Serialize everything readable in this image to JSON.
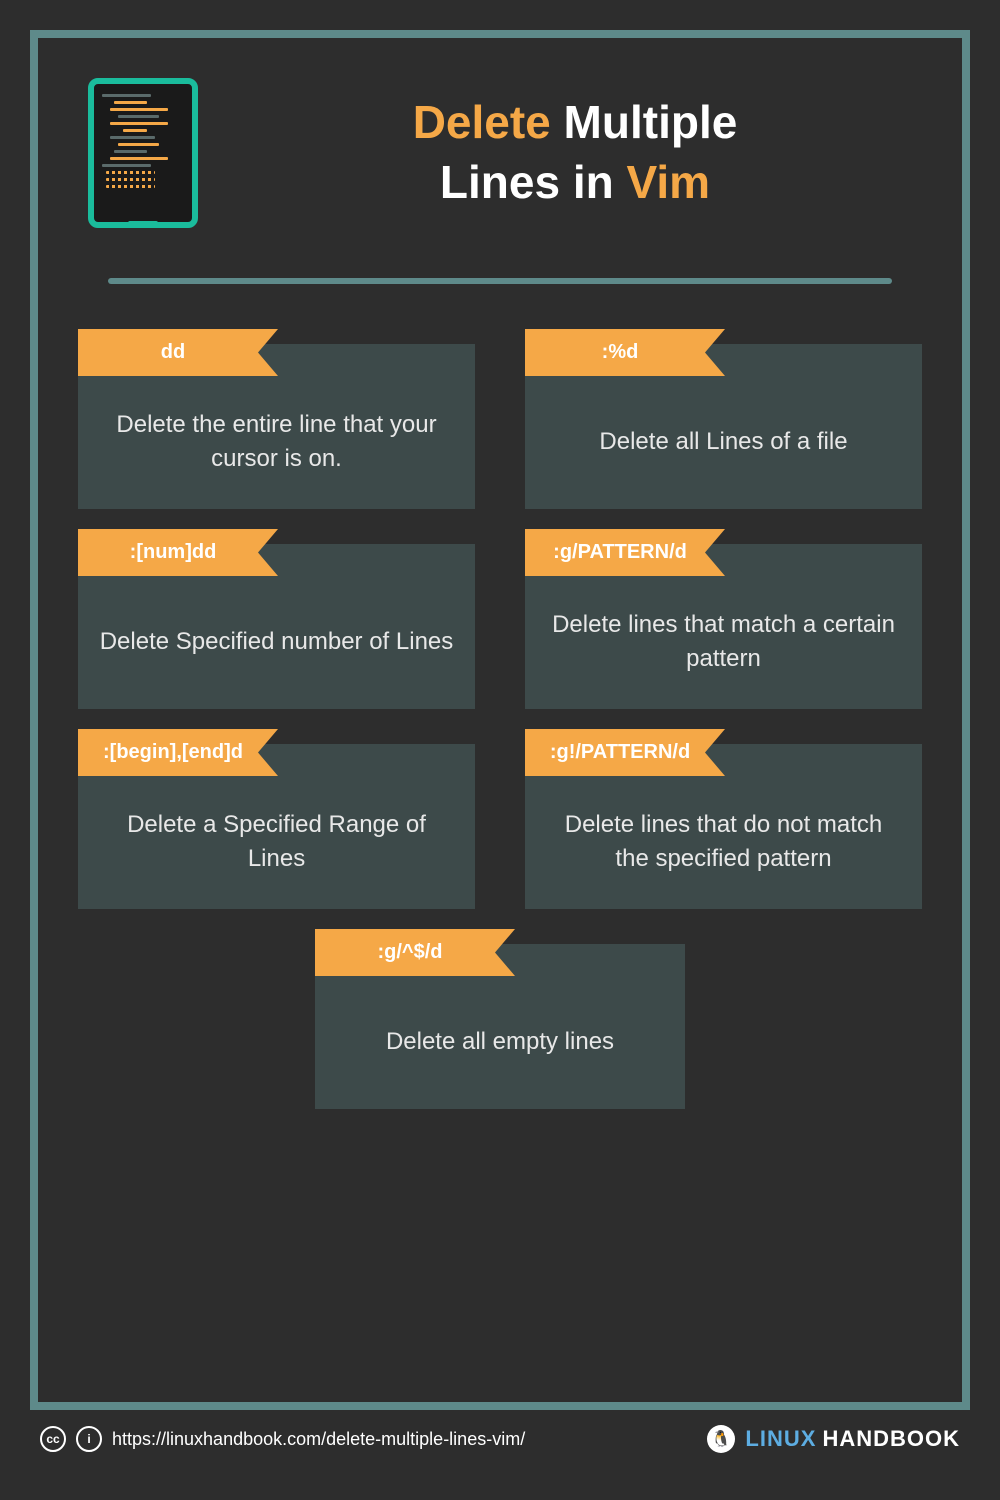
{
  "title": {
    "word1": "Delete",
    "word2": "Multiple",
    "word3": "Lines in",
    "word4": "Vim"
  },
  "cards": [
    {
      "command": "dd",
      "description": "Delete the entire line that your cursor is on."
    },
    {
      "command": ":%d",
      "description": "Delete all Lines of a file"
    },
    {
      "command": ":[num]dd",
      "description": "Delete Specified number of Lines"
    },
    {
      "command": ":g/PATTERN/d",
      "description": "Delete lines that match a certain pattern"
    },
    {
      "command": ":[begin],[end]d",
      "description": "Delete a Specified Range of Lines"
    },
    {
      "command": ":g!/PATTERN/d",
      "description": "Delete lines that do not match the specified pattern"
    },
    {
      "command": ":g/^$/d",
      "description": "Delete all empty lines"
    }
  ],
  "footer": {
    "cc_text": "cc",
    "attr_text": "i",
    "url": "https://linuxhandbook.com/delete-multiple-lines-vim/",
    "brand_linux": "LINUX",
    "brand_handbook": "HANDBOOK"
  }
}
